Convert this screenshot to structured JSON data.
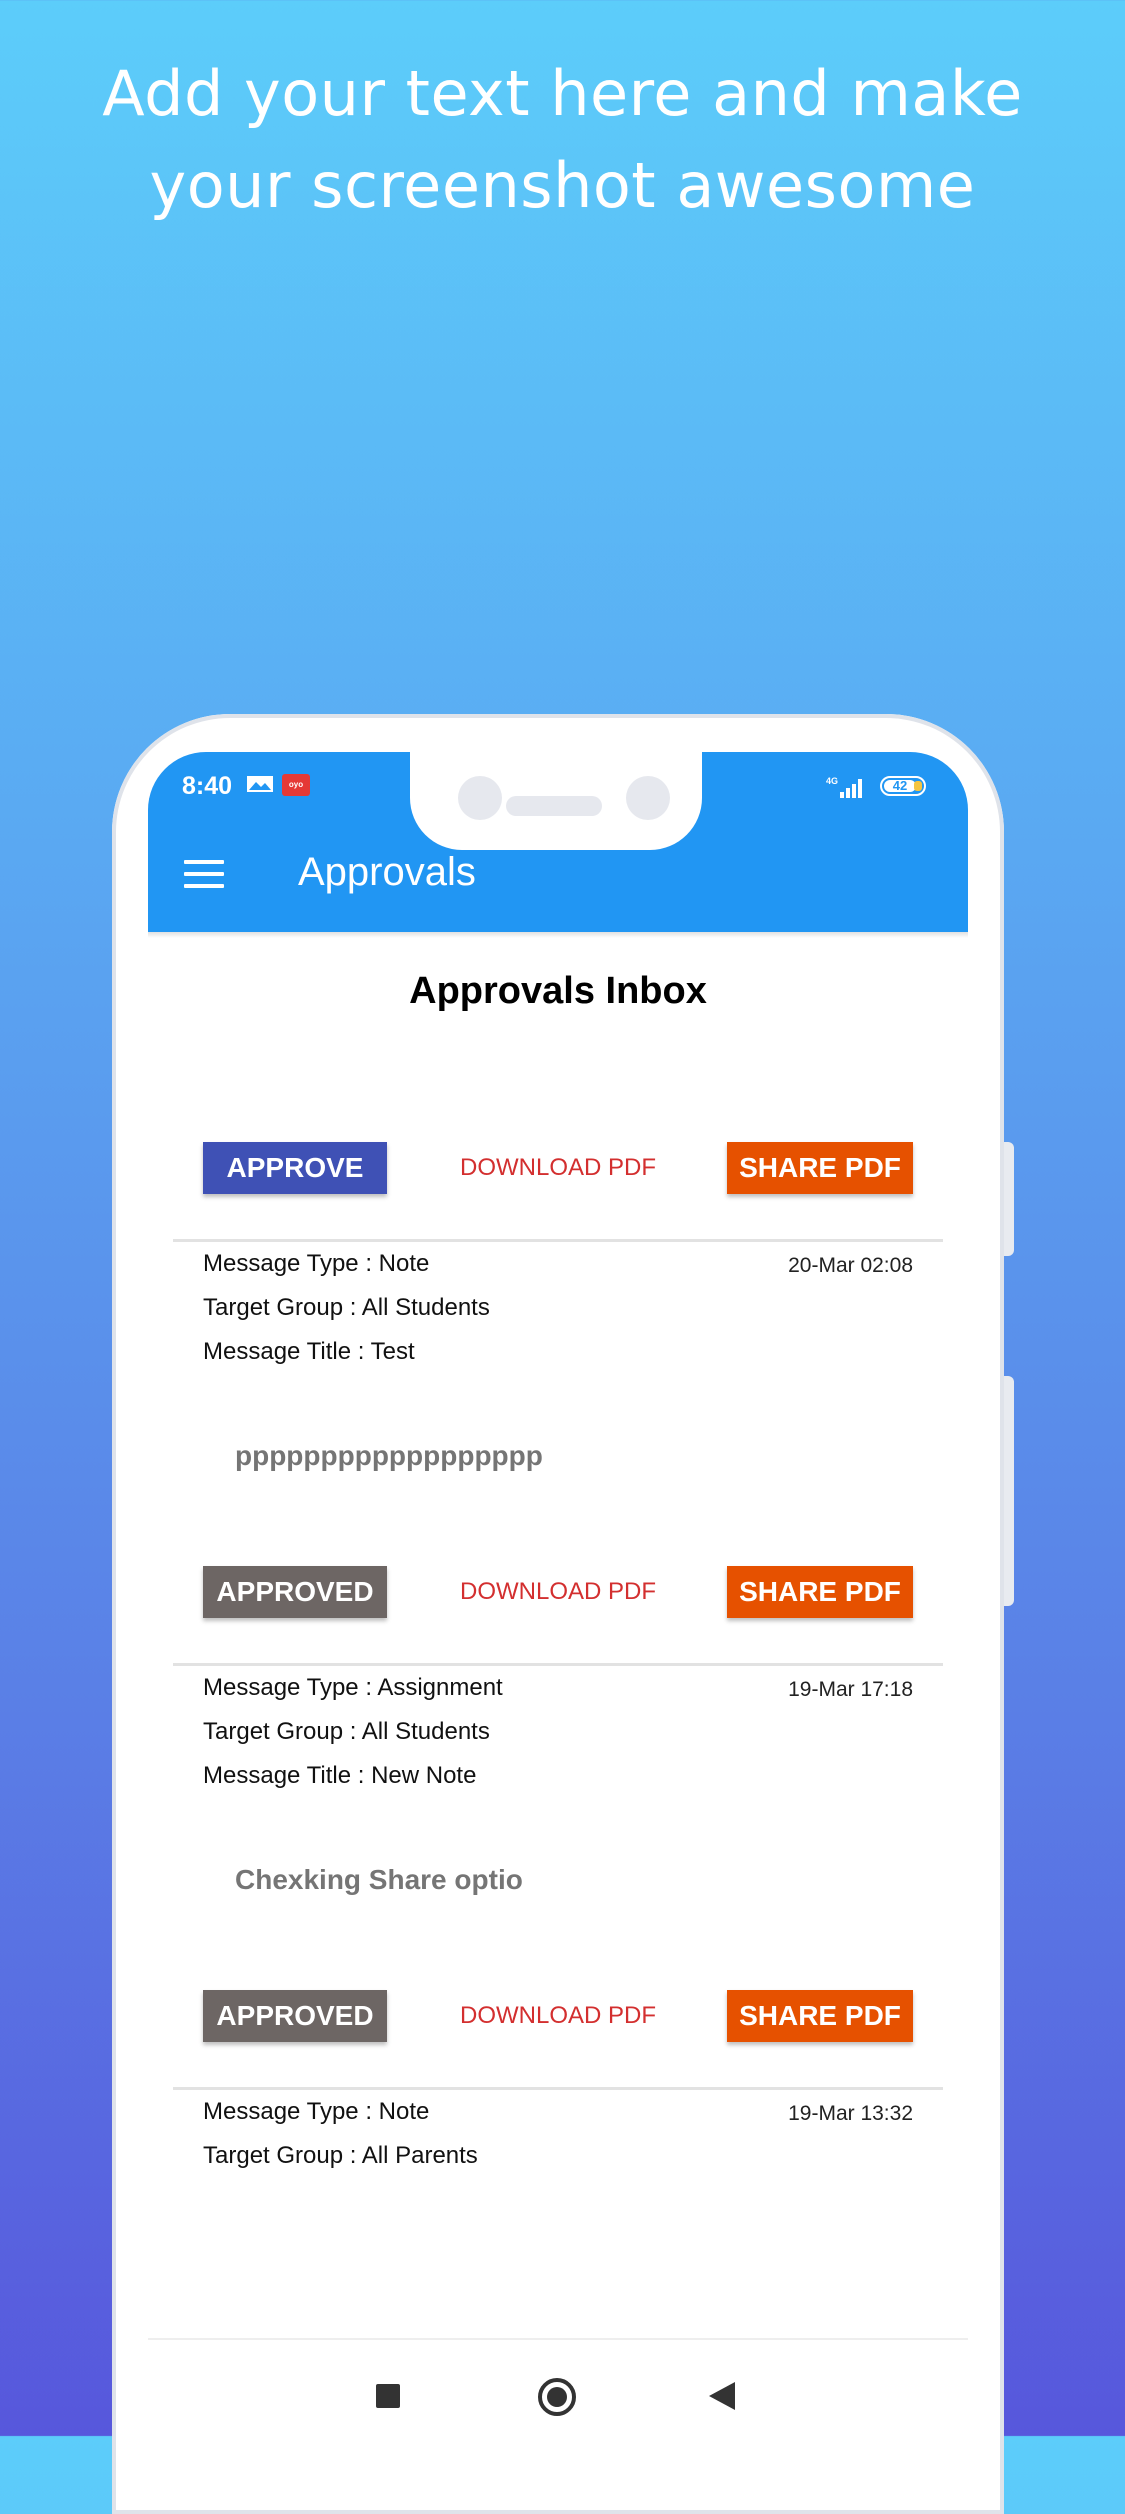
{
  "promo": {
    "line1": "Add your text here and make",
    "line2": "your screenshot awesome"
  },
  "status_bar": {
    "time": "8:40",
    "network": "4G",
    "battery": "42",
    "app_badge": "oyo"
  },
  "app_bar": {
    "title": "Approvals",
    "menu_icon": "hamburger-menu-icon"
  },
  "page": {
    "title": "Approvals Inbox"
  },
  "messages": [
    {
      "status_button": "APPROVE",
      "download_label": "DOWNLOAD PDF",
      "share_label": "SHARE PDF",
      "type_line": "Message Type : Note",
      "date": "20-Mar 02:08",
      "group_line": "Target Group  : All Students",
      "title_line": "Message Title  : Test",
      "body": "pppppppppppppppppp"
    },
    {
      "status_button": "APPROVED",
      "download_label": "DOWNLOAD PDF",
      "share_label": "SHARE PDF",
      "type_line": "Message Type : Assignment",
      "date": "19-Mar 17:18",
      "group_line": "Target Group  : All Students",
      "title_line": "Message Title  : New Note",
      "body": "Chexking Share optio"
    },
    {
      "status_button": "APPROVED",
      "download_label": "DOWNLOAD PDF",
      "share_label": "SHARE PDF",
      "type_line": "Message Type : Note",
      "date": "19-Mar 13:32",
      "group_line": "Target Group  : All Parents"
    }
  ],
  "colors": {
    "app_bar": "#2196f3",
    "approve": "#3f51b5",
    "approved": "#6d6664",
    "share": "#e65100",
    "download": "#d32f2f"
  },
  "nav": {
    "recents": "square-recents-icon",
    "home": "circle-home-icon",
    "back": "triangle-back-icon"
  }
}
